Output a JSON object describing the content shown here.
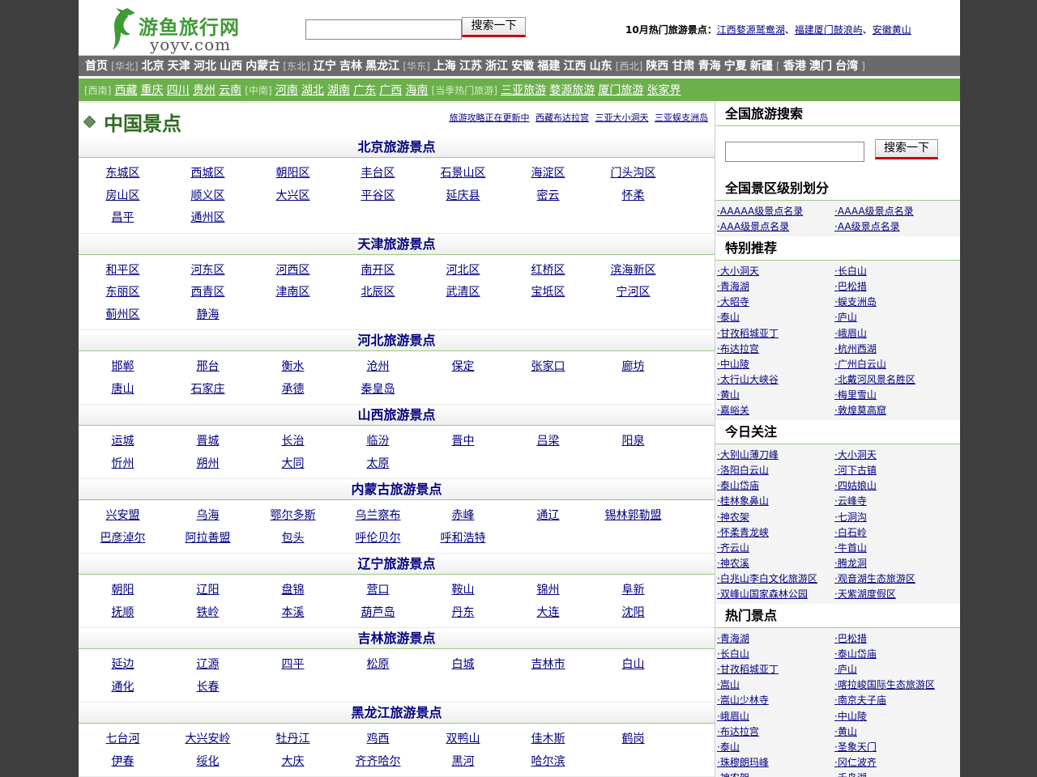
{
  "logo": {
    "cn": "游鱼旅行网",
    "en": "yoyv.com"
  },
  "search": {
    "button": "搜索一下",
    "value": ""
  },
  "hot": {
    "label": "10月热门旅游景点：",
    "links": [
      "江西婺源鹫鸯湖",
      "福建厦门鼓浪屿",
      "安徽黄山"
    ],
    "sep": "、"
  },
  "nav1": [
    {
      "t": "link",
      "v": "首页"
    },
    {
      "t": "grp",
      "v": "[华北]"
    },
    {
      "t": "link",
      "v": "北京"
    },
    {
      "t": "link",
      "v": "天津"
    },
    {
      "t": "link",
      "v": "河北"
    },
    {
      "t": "link",
      "v": "山西"
    },
    {
      "t": "link",
      "v": "内蒙古"
    },
    {
      "t": "grp",
      "v": "[东北]"
    },
    {
      "t": "link",
      "v": "辽宁"
    },
    {
      "t": "link",
      "v": "吉林"
    },
    {
      "t": "link",
      "v": "黑龙江"
    },
    {
      "t": "grp",
      "v": "[华东]"
    },
    {
      "t": "link",
      "v": "上海"
    },
    {
      "t": "link",
      "v": "江苏"
    },
    {
      "t": "link",
      "v": "浙江"
    },
    {
      "t": "link",
      "v": "安徽"
    },
    {
      "t": "link",
      "v": "福建"
    },
    {
      "t": "link",
      "v": "江西"
    },
    {
      "t": "link",
      "v": "山东"
    },
    {
      "t": "grp",
      "v": "[西北]"
    },
    {
      "t": "link",
      "v": "陕西"
    },
    {
      "t": "link",
      "v": "甘肃"
    },
    {
      "t": "link",
      "v": "青海"
    },
    {
      "t": "link",
      "v": "宁夏"
    },
    {
      "t": "link",
      "v": "新疆"
    },
    {
      "t": "grp",
      "v": "["
    },
    {
      "t": "link",
      "v": "香港"
    },
    {
      "t": "link",
      "v": "澳门"
    },
    {
      "t": "link",
      "v": "台湾"
    },
    {
      "t": "grp",
      "v": "]"
    }
  ],
  "nav2": [
    {
      "t": "grp",
      "v": "[西南]"
    },
    {
      "t": "link",
      "v": "西藏"
    },
    {
      "t": "link",
      "v": "重庆"
    },
    {
      "t": "link",
      "v": "四川"
    },
    {
      "t": "link",
      "v": "贵州"
    },
    {
      "t": "link",
      "v": "云南"
    },
    {
      "t": "grp",
      "v": "[中南]"
    },
    {
      "t": "link",
      "v": "河南"
    },
    {
      "t": "link",
      "v": "湖北"
    },
    {
      "t": "link",
      "v": "湖南"
    },
    {
      "t": "link",
      "v": "广东"
    },
    {
      "t": "link",
      "v": "广西"
    },
    {
      "t": "link",
      "v": "海南"
    },
    {
      "t": "grp",
      "v": "[当季热门旅游]"
    },
    {
      "t": "link",
      "v": "三亚旅游"
    },
    {
      "t": "link",
      "v": "婺源旅游"
    },
    {
      "t": "link",
      "v": "厦门旅游"
    },
    {
      "t": "link",
      "v": "张家界"
    }
  ],
  "main": {
    "title": "中国景点",
    "title_links": [
      "旅游攻略正在更新中",
      "西藏布达拉宫",
      "三亚大小洞天",
      "三亚蜈支洲岛"
    ],
    "sections": [
      {
        "title": "北京旅游景点",
        "items": [
          "东城区",
          "西城区",
          "朝阳区",
          "丰台区",
          "石景山区",
          "海淀区",
          "门头沟区",
          "房山区",
          "顺义区",
          "大兴区",
          "平谷区",
          "延庆县",
          "密云",
          "怀柔",
          "昌平",
          "通州区"
        ]
      },
      {
        "title": "天津旅游景点",
        "items": [
          "和平区",
          "河东区",
          "河西区",
          "南开区",
          "河北区",
          "红桥区",
          "滨海新区",
          "东丽区",
          "西青区",
          "津南区",
          "北辰区",
          "武清区",
          "宝坻区",
          "宁河区",
          "蓟州区",
          "静海"
        ]
      },
      {
        "title": "河北旅游景点",
        "items": [
          "邯郸",
          "邢台",
          "衡水",
          "沧州",
          "保定",
          "张家口",
          "廊坊",
          "唐山",
          "石家庄",
          "承德",
          "秦皇岛"
        ]
      },
      {
        "title": "山西旅游景点",
        "items": [
          "运城",
          "晋城",
          "长治",
          "临汾",
          "晋中",
          "吕梁",
          "阳泉",
          "忻州",
          "朔州",
          "大同",
          "太原"
        ]
      },
      {
        "title": "内蒙古旅游景点",
        "items": [
          "兴安盟",
          "乌海",
          "鄂尔多斯",
          "乌兰察布",
          "赤峰",
          "通辽",
          "锡林郭勒盟",
          "巴彦淖尔",
          "阿拉善盟",
          "包头",
          "呼伦贝尔",
          "呼和浩特"
        ]
      },
      {
        "title": "辽宁旅游景点",
        "items": [
          "朝阳",
          "辽阳",
          "盘锦",
          "营口",
          "鞍山",
          "锦州",
          "阜新",
          "抚顺",
          "铁岭",
          "本溪",
          "葫芦岛",
          "丹东",
          "大连",
          "沈阳"
        ]
      },
      {
        "title": "吉林旅游景点",
        "items": [
          "延边",
          "辽源",
          "四平",
          "松原",
          "白城",
          "吉林市",
          "白山",
          "通化",
          "长春"
        ]
      },
      {
        "title": "黑龙江旅游景点",
        "items": [
          "七台河",
          "大兴安岭",
          "牡丹江",
          "鸡西",
          "双鸭山",
          "佳木斯",
          "鹤岗",
          "伊春",
          "绥化",
          "大庆",
          "齐齐哈尔",
          "黑河",
          "哈尔滨"
        ]
      }
    ]
  },
  "sidebar": {
    "search_title": "全国旅游搜索",
    "search_button": "搜索一下",
    "blocks": [
      {
        "title": "全国景区级别划分",
        "items": [
          "AAAAA级景点名录",
          "AAAA级景点名录",
          "AAA级景点名录",
          "AA级景点名录"
        ]
      },
      {
        "title": "特别推荐",
        "items": [
          "大小洞天",
          "长白山",
          "青海湖",
          "巴松措",
          "大昭寺",
          "蜈支洲岛",
          "泰山",
          "庐山",
          "甘孜稻城亚丁",
          "峨眉山",
          "布达拉宫",
          "杭州西湖",
          "中山陵",
          "广州白云山",
          "太行山大峡谷",
          "北戴河风景名胜区",
          "黄山",
          "梅里雪山",
          "嘉峪关",
          "敦煌莫高窟"
        ]
      },
      {
        "title": "今日关注",
        "items": [
          "大别山薄刀峰",
          "大小洞天",
          "洛阳白云山",
          "河下古镇",
          "泰山岱庙",
          "四姑娘山",
          "桂林象鼻山",
          "云峰寺",
          "神农架",
          "七洞沟",
          "怀柔青龙峡",
          "白石岭",
          "齐云山",
          "牛首山",
          "神农溪",
          "腾龙洞",
          "白兆山李白文化旅游区",
          "观音湖生态旅游区",
          "双峰山国家森林公园",
          "天紫湖度假区"
        ]
      },
      {
        "title": "热门景点",
        "items": [
          "青海湖",
          "巴松措",
          "长白山",
          "泰山岱庙",
          "甘孜稻城亚丁",
          "庐山",
          "嵩山",
          "喀拉峻国际生态旅游区",
          "嵩山少林寺",
          "南京夫子庙",
          "峨眉山",
          "中山陵",
          "布达拉宫",
          "黄山",
          "泰山",
          "圣象天门",
          "珠穆朗玛峰",
          "冈仁波齐",
          "神农架",
          "千岛湖"
        ]
      }
    ]
  }
}
